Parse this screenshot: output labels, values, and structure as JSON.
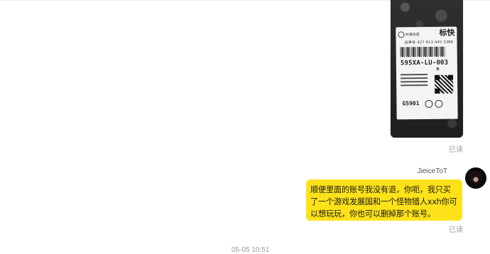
{
  "conversation": {
    "photo_message": {
      "label": {
        "brand_text": "中通快递",
        "service": "标快",
        "tracking": "运单号 427 913 445 3386",
        "sort_code": "595XA-LU-003",
        "sort_sub": "集",
        "code": "G5901"
      },
      "read_status": "已读"
    },
    "sender": {
      "name": "JieiceToT"
    },
    "text_message": {
      "text": "顺便里面的账号我没有退，你呃，我只买了一个游戏发展国和一个怪物猎人xxh你可以想玩玩，你也可以删掉那个账号。",
      "read_status": "已读"
    },
    "timestamp": "05-05 10:51"
  },
  "colors": {
    "bubble_background": "#fde21a",
    "read_status_text": "#9a9a9a",
    "background": "#ffffff"
  }
}
